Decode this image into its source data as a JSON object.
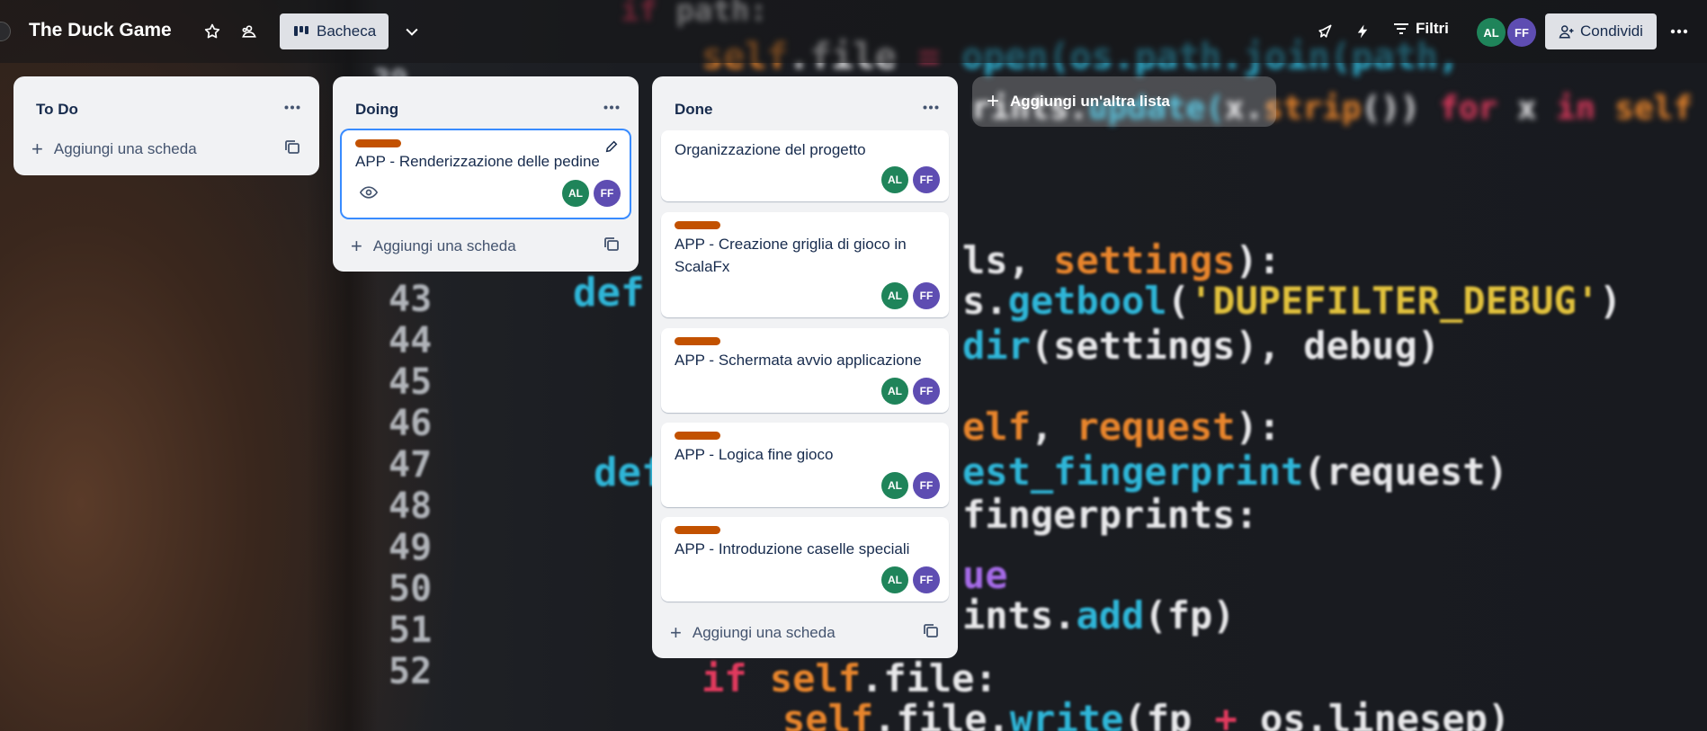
{
  "board": {
    "title": "The Duck Game",
    "view_label": "Bacheca",
    "filters_label": "Filtri",
    "share_label": "Condividi",
    "members": [
      "AL",
      "FF"
    ]
  },
  "icons": {
    "star": "star-icon",
    "workspace": "workspace-visibility-icon",
    "board_view": "board-view-icon",
    "chevron": "chevron-down-icon",
    "power_ups": "rocket-icon",
    "automation": "lightning-icon",
    "filter": "filter-icon",
    "share": "add-person-icon",
    "more": "more-icon"
  },
  "colors": {
    "label_orange": "#c25100",
    "avatar_al": "#1f845a",
    "avatar_ff": "#5e4db2",
    "list_bg": "#f1f2f4",
    "active_card_border": "#388bff"
  },
  "lists": [
    {
      "title": "To Do",
      "add_card_label": "Aggiungi una scheda",
      "cards": []
    },
    {
      "title": "Doing",
      "add_card_label": "Aggiungi una scheda",
      "cards": [
        {
          "title": "APP - Renderizzazione delle pedine",
          "label": true,
          "watched": true,
          "members": [
            "AL",
            "FF"
          ]
        }
      ]
    },
    {
      "title": "Done",
      "add_card_label": "Aggiungi una scheda",
      "cards": [
        {
          "title": "Organizzazione del progetto",
          "label": false,
          "members": [
            "AL",
            "FF"
          ]
        },
        {
          "title": "APP - Creazione griglia di gioco in ScalaFx",
          "label": true,
          "members": [
            "AL",
            "FF"
          ]
        },
        {
          "title": "APP - Schermata avvio applicazione",
          "label": true,
          "members": [
            "AL",
            "FF"
          ]
        },
        {
          "title": "APP - Logica fine gioco",
          "label": true,
          "members": [
            "AL",
            "FF"
          ]
        },
        {
          "title": "APP - Introduzione caselle speciali",
          "label": true,
          "members": [
            "AL",
            "FF"
          ]
        }
      ]
    }
  ],
  "add_list_label": "Aggiungi un'altra lista"
}
